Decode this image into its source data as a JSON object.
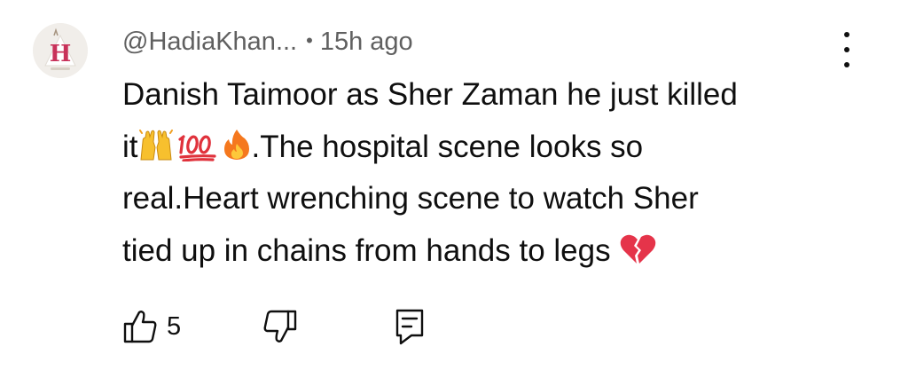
{
  "comment": {
    "author": "@HadiaKhan...",
    "separator": "•",
    "time": "15h ago",
    "body_lines": [
      "Danish Taimoor as Sher Zaman he just killed",
      "it",
      ".The hospital scene looks so",
      "real.Heart wrenching scene to watch Sher",
      "tied up in chains from hands to legs "
    ],
    "emojis": [
      "raising-hands",
      "hundred-points",
      "fire",
      "broken-heart"
    ],
    "like_count": "5"
  },
  "icons": {
    "avatar": "avatar-letter-h",
    "more": "vertical-ellipsis-icon",
    "like": "thumbs-up-icon",
    "dislike": "thumbs-down-icon",
    "reply": "reply-comment-icon"
  },
  "colors": {
    "text": "#0f0f0f",
    "secondary_text": "#606060",
    "avatar_letter": "#c8325a",
    "fire": "#f5781e",
    "hundred": "#e0323c",
    "broken_heart": "#e5344a",
    "hands": "#f7c02e"
  }
}
